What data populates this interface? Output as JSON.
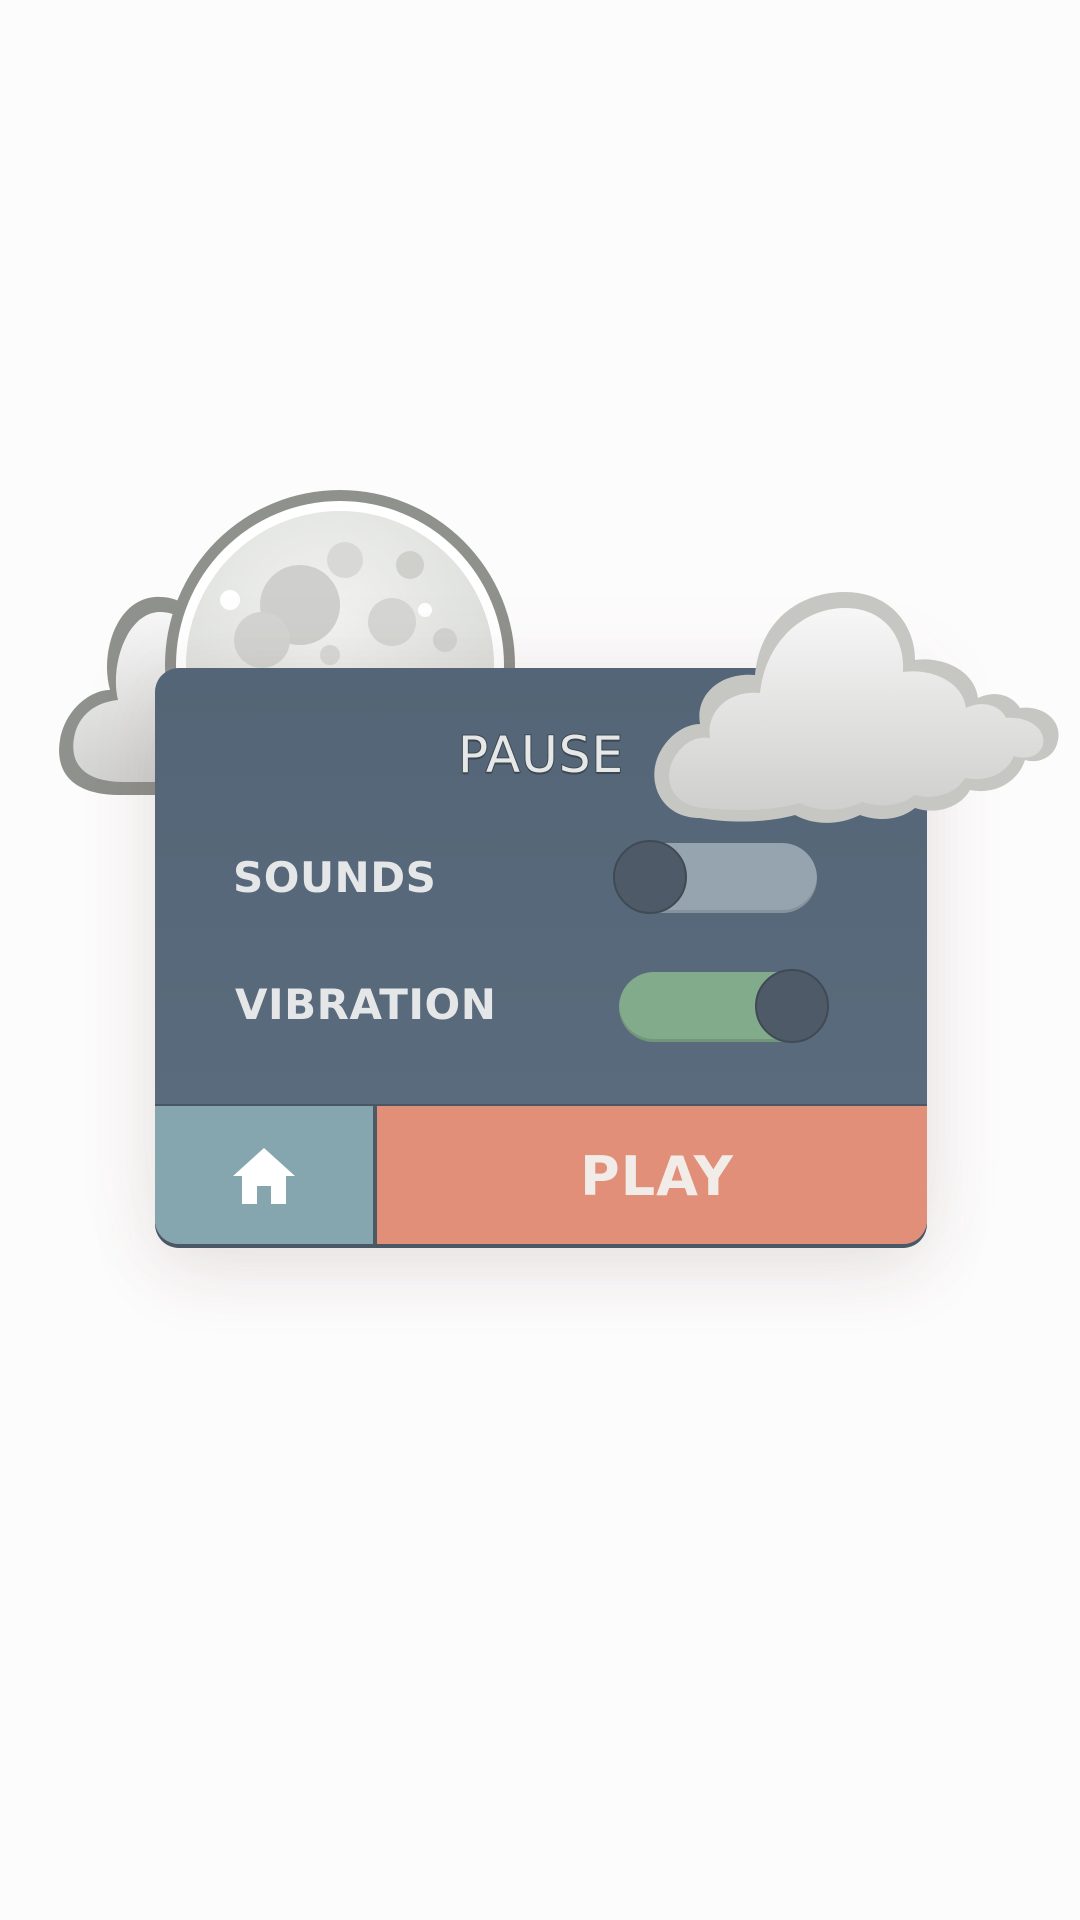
{
  "pause_menu": {
    "title": "PAUSE",
    "settings": [
      {
        "label": "SOUNDS",
        "enabled": false
      },
      {
        "label": "VIBRATION",
        "enabled": true
      }
    ],
    "home_icon": "home-icon",
    "play_label": "PLAY"
  },
  "decor": {
    "moon": "moon-icon",
    "clouds": [
      "cloud-icon",
      "cloud-icon"
    ]
  },
  "colors": {
    "background": "#fdfcfc",
    "panel": "#566878",
    "toggle_off": "#95a4ae",
    "toggle_on": "#82ab8b",
    "knob": "#4e5a67",
    "home_button": "#85a6ae",
    "play_button": "#e28f79",
    "text": "#e4e6e8"
  }
}
